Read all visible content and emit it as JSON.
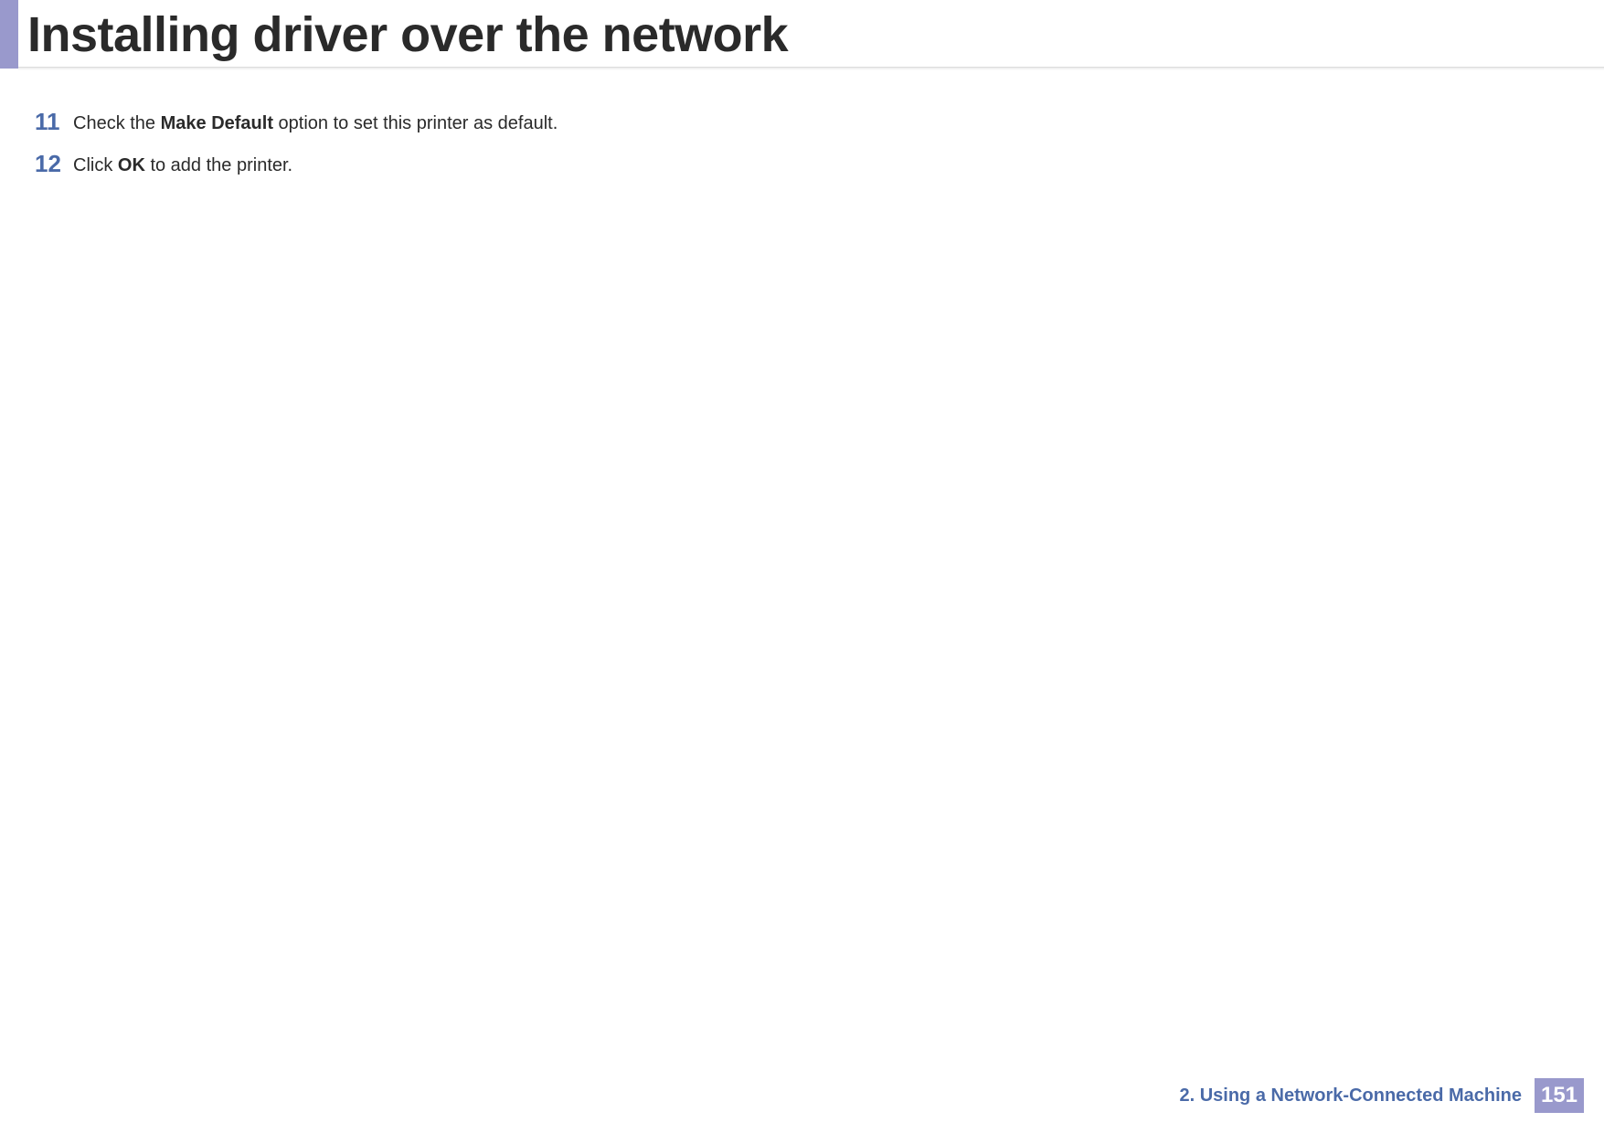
{
  "header": {
    "title": "Installing driver over the network"
  },
  "steps": [
    {
      "number": "11",
      "text_pre": "Check the ",
      "bold": "Make Default",
      "text_post": " option to set this printer as default."
    },
    {
      "number": "12",
      "text_pre": "Click ",
      "bold": "OK",
      "text_post": " to add the printer."
    }
  ],
  "footer": {
    "chapter": "2.  Using a Network-Connected Machine",
    "page": "151"
  }
}
